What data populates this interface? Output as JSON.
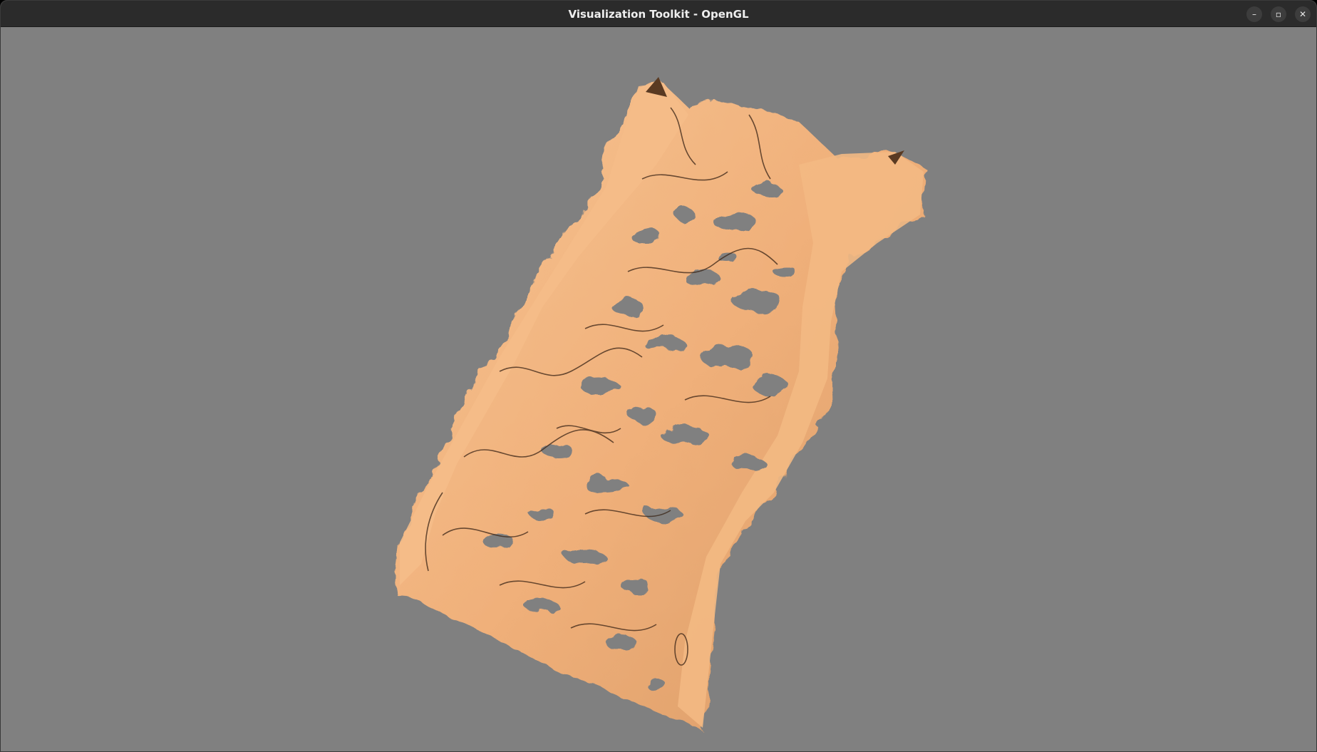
{
  "window": {
    "title": "Visualization Toolkit - OpenGL"
  },
  "controls": {
    "minimize_icon": "–",
    "maximize_icon": "▫",
    "close_icon": "✕"
  },
  "scene": {
    "background_color": "#808080",
    "surface_color": "#F2B27C",
    "shadow_color": "#3a2416"
  }
}
